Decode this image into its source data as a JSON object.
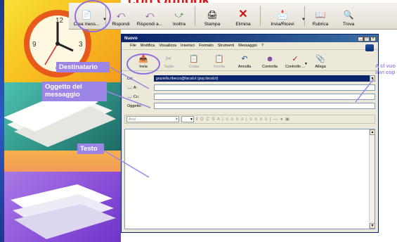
{
  "headline": "con Outlook",
  "outer_toolbar": {
    "buttons": [
      {
        "label": "Crea mess...",
        "icon": "new-message-icon"
      },
      {
        "label": "Rispondi",
        "icon": "reply-icon"
      },
      {
        "label": "Rispondi a...",
        "icon": "reply-all-icon"
      },
      {
        "label": "Inoltra",
        "icon": "forward-icon"
      },
      {
        "label": "Stampa",
        "icon": "print-icon"
      },
      {
        "label": "Elimina",
        "icon": "delete-icon"
      },
      {
        "label": "Invia/Ricevi",
        "icon": "send-receive-icon"
      },
      {
        "label": "Rubrica",
        "icon": "address-book-icon"
      },
      {
        "label": "Trova",
        "icon": "find-icon"
      }
    ]
  },
  "window": {
    "title": "Nuovo",
    "controls": [
      "_",
      "□",
      "×"
    ],
    "menu": [
      "File",
      "Modifica",
      "Visualizza",
      "Inserisci",
      "Formato",
      "Strumenti",
      "Messaggio",
      "?"
    ],
    "toolbar": [
      {
        "label": "Invia",
        "icon": "send-icon",
        "enabled": true
      },
      {
        "label": "Taglia",
        "icon": "cut-icon",
        "enabled": false
      },
      {
        "label": "Copia",
        "icon": "copy-icon",
        "enabled": false
      },
      {
        "label": "Incolla",
        "icon": "paste-icon",
        "enabled": false
      },
      {
        "label": "Annulla",
        "icon": "undo-icon",
        "enabled": true
      },
      {
        "label": "Controlla",
        "icon": "check-names-icon",
        "enabled": true
      },
      {
        "label": "Controllo ...",
        "icon": "spelling-icon",
        "enabled": true
      },
      {
        "label": "Allega",
        "icon": "attach-icon",
        "enabled": true
      }
    ],
    "fields": {
      "from_label": "Da:",
      "from_value": "graziella.ribecco@tiscali.it   (pop.tiscali.it)",
      "to_label": "A:",
      "to_value": "",
      "cc_label": "Cc:",
      "cc_value": "",
      "subject_label": "Oggetto:",
      "subject_value": ""
    },
    "format": {
      "font": "Arial",
      "size": ""
    }
  },
  "callouts": {
    "destinatario": "Destinatario",
    "oggetto": "Oggetto del messaggio",
    "testo": "Testo",
    "right": "A cl vuo invi cop"
  },
  "colors": {
    "callout": "#9d85e6",
    "headline": "#d81c1c",
    "titlebar": "#0a246a"
  }
}
